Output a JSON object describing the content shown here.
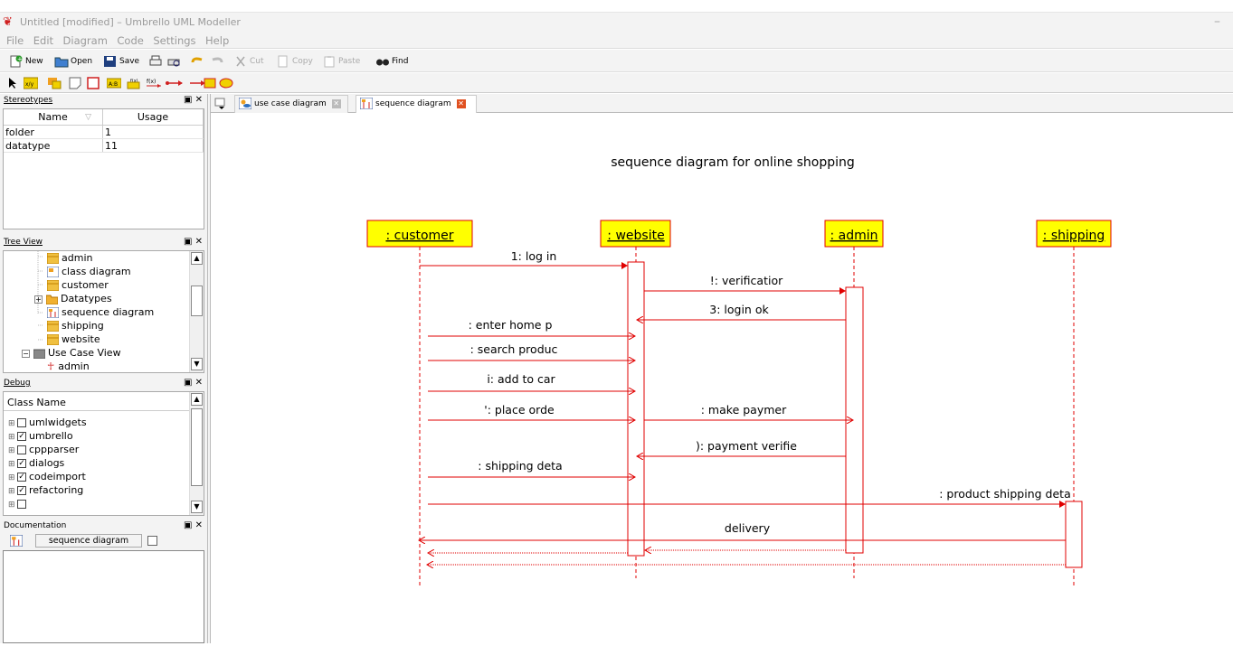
{
  "window": {
    "title": "Untitled [modified] – Umbrello UML Modeller"
  },
  "menu": [
    "File",
    "Edit",
    "Diagram",
    "Code",
    "Settings",
    "Help"
  ],
  "toolbar": {
    "new": "New",
    "open": "Open",
    "save": "Save",
    "cut": "Cut",
    "copy": "Copy",
    "paste": "Paste",
    "find": "Find"
  },
  "stereotypes": {
    "header": "Stereotypes",
    "col_name": "Name",
    "col_usage": "Usage",
    "rows": [
      {
        "name": "folder",
        "usage": "1"
      },
      {
        "name": "datatype",
        "usage": "11"
      }
    ]
  },
  "treeview": {
    "header": "Tree View",
    "items": [
      "admin",
      "class diagram",
      "customer",
      "Datatypes",
      "sequence diagram",
      "shipping",
      "website",
      "Use Case View",
      "admin"
    ]
  },
  "debug": {
    "header": "Debug",
    "col": "Class Name",
    "items": [
      {
        "name": "umlwidgets",
        "checked": false
      },
      {
        "name": "umbrello",
        "checked": true
      },
      {
        "name": "cppparser",
        "checked": false
      },
      {
        "name": "dialogs",
        "checked": true
      },
      {
        "name": "codeimport",
        "checked": true
      },
      {
        "name": "refactoring",
        "checked": true
      }
    ]
  },
  "documentation": {
    "header": "Documentation",
    "diagram_name": "sequence diagram"
  },
  "tabs": [
    {
      "label": "use case diagram"
    },
    {
      "label": "sequence diagram"
    }
  ],
  "diagram": {
    "title": "sequence diagram for online shopping",
    "objects": [
      ": customer",
      ": website",
      ": admin",
      ": shipping"
    ],
    "messages": [
      "1: log in",
      "!: verificatior",
      "3: login ok",
      ": enter home p",
      ": search produc",
      "i: add to car",
      "': place orde",
      ": make paymer",
      "): payment verifie",
      ": shipping deta",
      ": product shipping deta",
      "delivery"
    ],
    "colors": {
      "object_fill": "#ffff00",
      "line": "#e00000"
    }
  }
}
